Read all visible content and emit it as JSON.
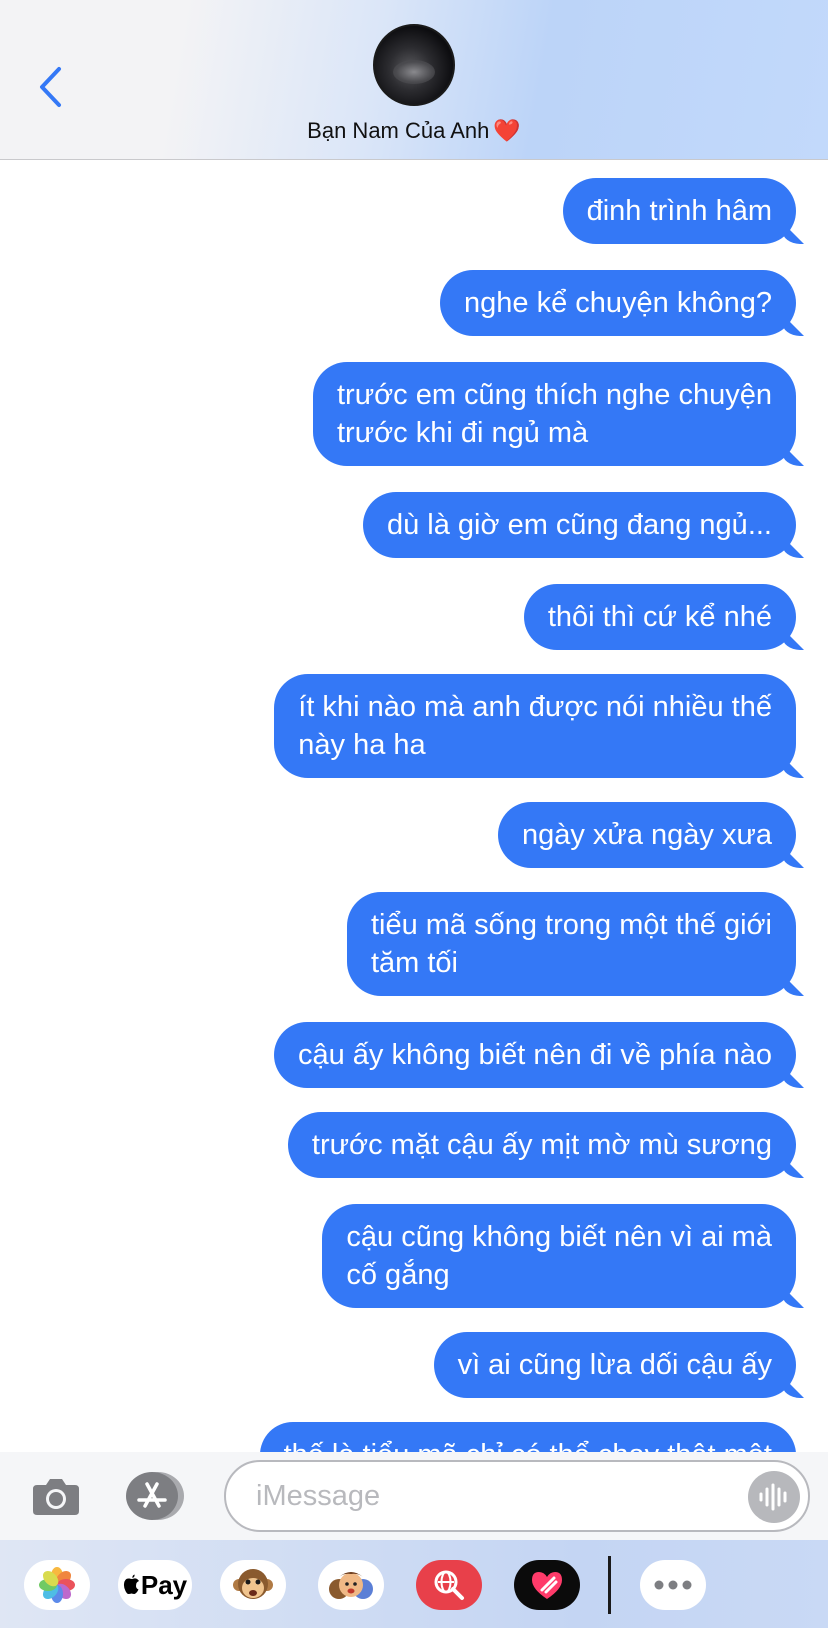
{
  "header": {
    "contact_name": "Bạn Nam Của Anh",
    "heart_glyph": "❤️"
  },
  "messages": [
    {
      "text": "đinh trình hâm"
    },
    {
      "text": "nghe kể chuyện không?"
    },
    {
      "text": "trước em cũng thích nghe chuyện\ntrước khi đi ngủ mà"
    },
    {
      "text": "dù là giờ em cũng đang ngủ..."
    },
    {
      "text": "thôi thì cứ kể nhé"
    },
    {
      "text": "ít khi nào mà anh được nói nhiều thế\nnày ha ha"
    },
    {
      "text": "ngày xửa ngày xưa"
    },
    {
      "text": "tiểu mã sống trong một thế giới\ntăm tối"
    },
    {
      "text": "cậu ấy không biết nên đi về phía nào"
    },
    {
      "text": "trước mặt cậu ấy mịt mờ mù sương"
    },
    {
      "text": "cậu cũng không biết nên vì ai mà\ncố gắng"
    },
    {
      "text": "vì ai cũng lừa dối cậu ấy"
    },
    {
      "text": "thế là tiểu mã chỉ có thể chạy thật một"
    }
  ],
  "input": {
    "placeholder": "iMessage"
  },
  "drawer": {
    "apple_pay_label": "Pay",
    "apps": [
      "photos-icon",
      "apple-pay-icon",
      "memoji-monkey-icon",
      "memoji-stickers-icon",
      "web-search-icon",
      "digital-touch-icon",
      "more-icon"
    ]
  },
  "colors": {
    "bubble_blue": "#3478f6",
    "ios_blue": "#3478f6"
  }
}
